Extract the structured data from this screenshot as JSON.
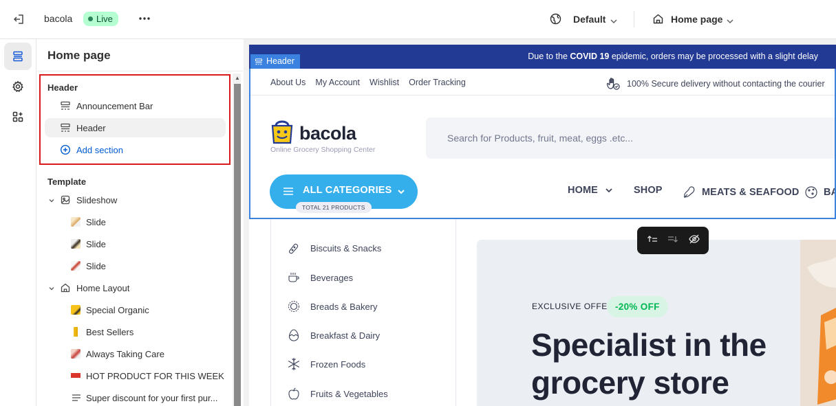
{
  "topbar": {
    "store_name": "bacola",
    "status_badge": "Live",
    "theme_select": "Default",
    "page_select": "Home page"
  },
  "sidebar": {
    "title": "Home page",
    "header_group": {
      "title": "Header",
      "items": [
        {
          "label": "Announcement Bar"
        },
        {
          "label": "Header"
        }
      ],
      "add_label": "Add section"
    },
    "template_group": {
      "title": "Template",
      "slideshow": {
        "label": "Slideshow",
        "children": [
          "Slide",
          "Slide",
          "Slide"
        ]
      },
      "home_layout": {
        "label": "Home Layout",
        "children": [
          "Special Organic",
          "Best Sellers",
          "Always Taking Care",
          "HOT PRODUCT FOR THIS WEEK",
          "Super discount for your first pur..."
        ]
      }
    }
  },
  "preview": {
    "header_tag": "Header",
    "announcement": {
      "prefix": "Due to the ",
      "bold": "COVID 19",
      "suffix": " epidemic, orders may be processed with a slight delay"
    },
    "top_links": [
      "About Us",
      "My Account",
      "Wishlist",
      "Order Tracking"
    ],
    "secure_text": "100% Secure delivery without contacting the courier",
    "logo": {
      "name": "bacola",
      "tagline": "Online Grocery Shopping Center"
    },
    "search_placeholder": "Search for Products, fruit, meat, eggs .etc...",
    "all_categories": "ALL CATEGORIES",
    "total_products": "TOTAL 21 PRODUCTS",
    "nav": [
      "HOME",
      "SHOP",
      "MEATS & SEAFOOD",
      "BA"
    ],
    "categories": [
      "Biscuits & Snacks",
      "Beverages",
      "Breads & Bakery",
      "Breakfast & Dairy",
      "Frozen Foods",
      "Fruits & Vegetables"
    ],
    "hero": {
      "eyebrow": "EXCLUSIVE OFFER",
      "discount": "-20% OFF",
      "headline_1": "Specialist in the",
      "headline_2": "grocery store"
    }
  },
  "colors": {
    "live_bg": "#b4fed2",
    "link_blue": "#005bd3",
    "highlight_red": "#d91a1a",
    "announce_bg": "#233a95",
    "category_button": "#35afeb",
    "discount_green": "#00b853"
  }
}
